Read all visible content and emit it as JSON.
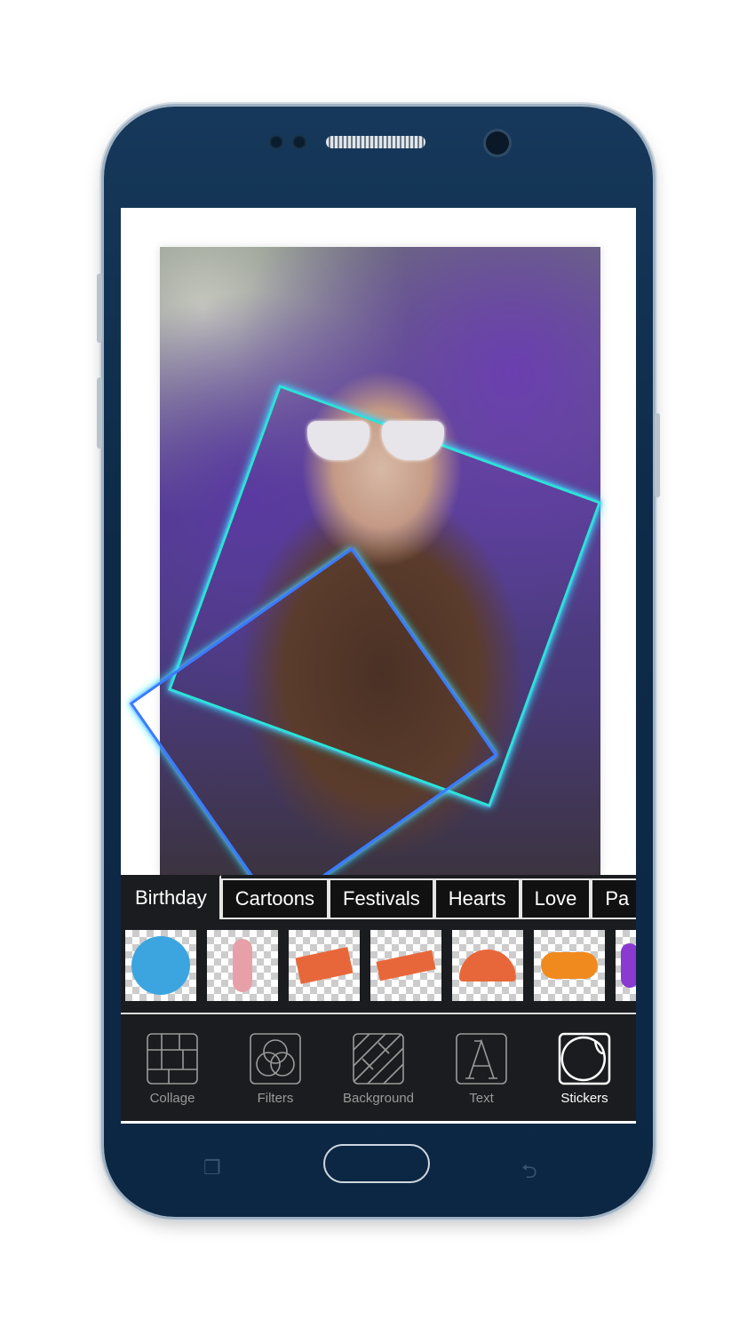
{
  "tabs": [
    {
      "label": "Birthday",
      "active": true
    },
    {
      "label": "Cartoons"
    },
    {
      "label": "Festivals"
    },
    {
      "label": "Hearts"
    },
    {
      "label": "Love"
    },
    {
      "label": "Pa"
    }
  ],
  "stickers": [
    {
      "name": "birthday-gift-badge",
      "color": "#3ca5e0"
    },
    {
      "name": "balloons-cake",
      "color": "#e8a0a8"
    },
    {
      "name": "happy-birthday-gift-ribbon",
      "color": "#e8673a"
    },
    {
      "name": "champagne-happy-birthday",
      "color": "#e8673a"
    },
    {
      "name": "happy-birthday-arch",
      "color": "#e8673a"
    },
    {
      "name": "candy",
      "color": "#f08a1e"
    },
    {
      "name": "purple-swirl",
      "color": "#8a3ad0"
    }
  ],
  "toolbar": [
    {
      "label": "Collage",
      "icon": "collage-icon"
    },
    {
      "label": "Filters",
      "icon": "filters-icon"
    },
    {
      "label": "Background",
      "icon": "background-icon"
    },
    {
      "label": "Text",
      "icon": "text-icon"
    },
    {
      "label": "Stickers",
      "icon": "sticker-icon",
      "active": true
    }
  ],
  "colors": {
    "phone_body": "#0d2a47",
    "panel": "#1b1c1f",
    "active_text": "#ffffff",
    "inactive_text": "#9a9a9a"
  }
}
